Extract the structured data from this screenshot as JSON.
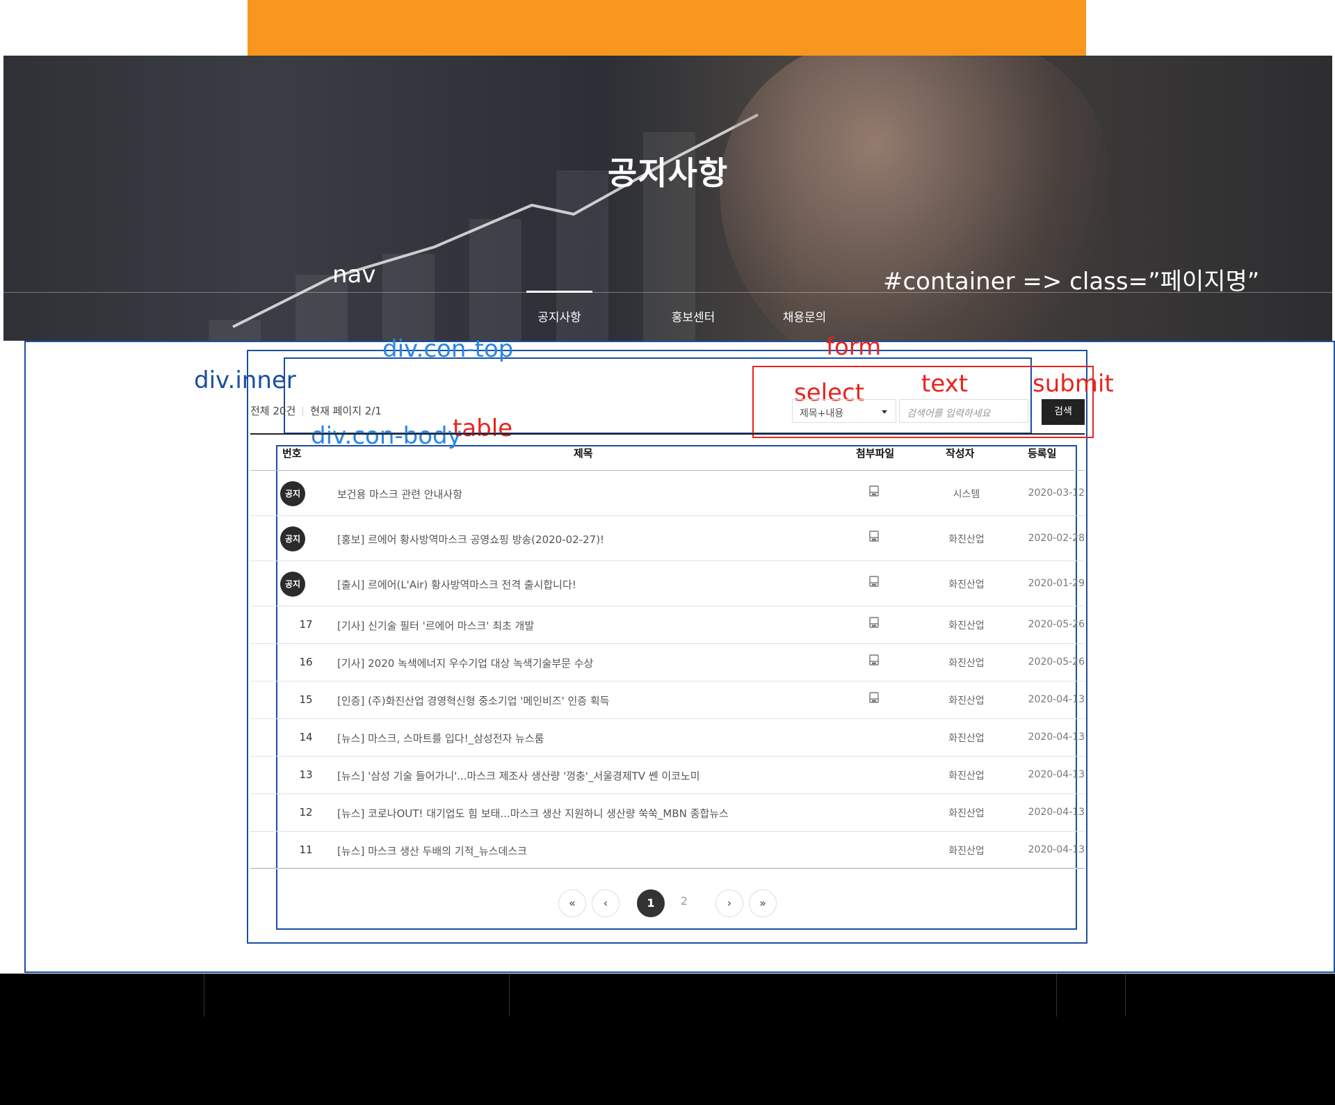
{
  "hero": {
    "title": "공지사항",
    "nav": [
      {
        "label": "공지사항",
        "active": true
      },
      {
        "label": "홍보센터",
        "active": false
      },
      {
        "label": "채용문의",
        "active": false
      }
    ]
  },
  "annotations": {
    "nav": "nav",
    "container": "#container  => class=”페이지명”",
    "inner": "div.inner",
    "con_top": "div.con-top",
    "form": "form",
    "select": "select",
    "text": "text",
    "submit": "submit",
    "con_body": "div.con-body",
    "table": "table"
  },
  "board": {
    "total": "전체 20건",
    "current_page": "현재 페이지 2/1",
    "select_value": "제목+내용",
    "search_placeholder": "검색어를 입력하세요",
    "search_button": "검색",
    "headers": [
      "번호",
      "제목",
      "첨부파일",
      "작성자",
      "등록일"
    ],
    "notice_badge": "공지",
    "rows": [
      {
        "num": "공지",
        "notice": true,
        "title": "보건용 마스크 관련 안내사항",
        "file": true,
        "author": "시스템",
        "date": "2020-03-12"
      },
      {
        "num": "공지",
        "notice": true,
        "title": "[홍보] 르에어 황사방역마스크 공영쇼핑 방송(2020-02-27)!",
        "file": true,
        "author": "화진산업",
        "date": "2020-02-28"
      },
      {
        "num": "공지",
        "notice": true,
        "title": "[출시] 르에어(L'Air) 황사방역마스크 전격 출시합니다!",
        "file": true,
        "author": "화진산업",
        "date": "2020-01-29"
      },
      {
        "num": "17",
        "notice": false,
        "title": "[기사] 신기술 필터 '르에어 마스크' 최초 개발",
        "file": true,
        "author": "화진산업",
        "date": "2020-05-26"
      },
      {
        "num": "16",
        "notice": false,
        "title": "[기사] 2020 녹색에너지 우수기업 대상 녹색기술부문 수상",
        "file": true,
        "author": "화진산업",
        "date": "2020-05-26"
      },
      {
        "num": "15",
        "notice": false,
        "title": "[인증] (주)화진산업 경영혁신형 중소기업 '메인비즈' 인증 획득",
        "file": true,
        "author": "화진산업",
        "date": "2020-04-13"
      },
      {
        "num": "14",
        "notice": false,
        "title": "[뉴스] 마스크, 스마트를 입다!_삼성전자 뉴스룸",
        "file": false,
        "author": "화진산업",
        "date": "2020-04-13"
      },
      {
        "num": "13",
        "notice": false,
        "title": "[뉴스] '삼성 기술 들어가니'...마스크 제조사 생산량 '껑충'_서울경제TV 쎈 이코노미",
        "file": false,
        "author": "화진산업",
        "date": "2020-04-13"
      },
      {
        "num": "12",
        "notice": false,
        "title": "[뉴스] 코로나OUT! 대기업도 힘 보태...마스크 생산 지원하니 생산량 쑥쑥_MBN 종합뉴스",
        "file": false,
        "author": "화진산업",
        "date": "2020-04-13"
      },
      {
        "num": "11",
        "notice": false,
        "title": "[뉴스] 마스크 생산 두배의 기적_뉴스데스크",
        "file": false,
        "author": "화진산업",
        "date": "2020-04-13"
      }
    ]
  },
  "pagination": {
    "first": "«",
    "prev": "‹",
    "pages": [
      "1",
      "2"
    ],
    "current": "1",
    "next": "›",
    "last": "»"
  },
  "colors": {
    "accent": "#f7971e",
    "annotation_navy": "#1a4ea1",
    "annotation_blue": "#2a86e8",
    "annotation_red": "#e8231f"
  }
}
